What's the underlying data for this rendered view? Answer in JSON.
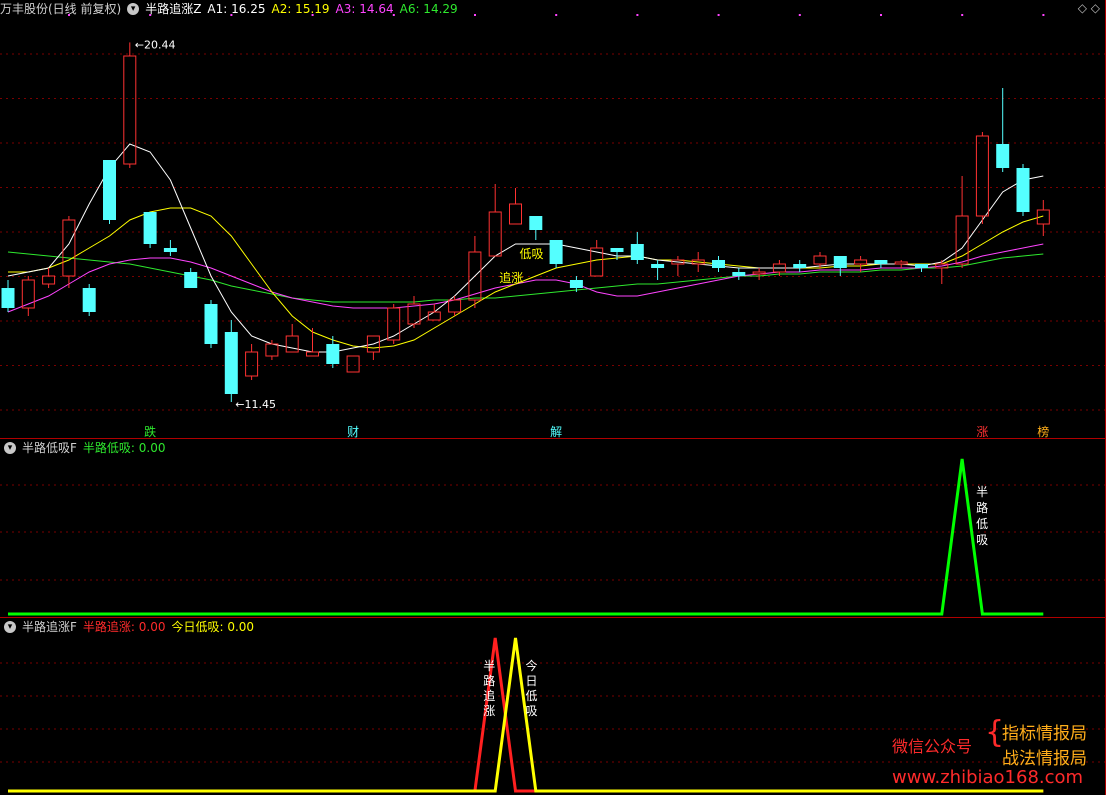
{
  "top_header": {
    "stock": "万丰股份(日线 前复权)",
    "indicator": "半路追涨Z",
    "a1": "A1: 16.25",
    "a2": "A2: 15.19",
    "a3": "A3: 14.64",
    "a6": "A6: 14.29"
  },
  "panel2_header": {
    "name": "半路低吸F",
    "series": "半路低吸: 0.00"
  },
  "panel3_header": {
    "name": "半路追涨F",
    "series1": "半路追涨: 0.00",
    "series2": "今日低吸: 0.00"
  },
  "watermark": {
    "left": "微信公众号",
    "right1": "指标情报局",
    "right2": "战法情报局",
    "url": "www.zhibiao168.com"
  },
  "colors": {
    "up": "#ff3232",
    "down": "#54ffff",
    "ma_white": "#ffffff",
    "ma_yellow": "#ffff00",
    "ma_magenta": "#ff44ff",
    "ma_green": "#2ee82e",
    "signal_green": "#00ff00",
    "signal_red": "#ff2020",
    "signal_yellow": "#ffff00",
    "grid": "#7a0000",
    "divider": "#b00000"
  },
  "chart_data": [
    {
      "type": "candlestick",
      "title": "半路追涨Z",
      "y_range": [
        11.0,
        21.0
      ],
      "grid": true,
      "annotations": {
        "max_label": "20.44",
        "min_label": "11.45",
        "signals": [
          {
            "index": 7,
            "text": "跌"
          },
          {
            "index": 17,
            "text": "财"
          },
          {
            "index": 27,
            "text": "解"
          },
          {
            "index": 48,
            "text": "涨"
          },
          {
            "index": 51,
            "text": "榜"
          }
        ],
        "chart_texts": [
          {
            "index": 25,
            "text": "低吸",
            "price": 15.05
          },
          {
            "index": 24,
            "text": "追涨",
            "price": 14.45
          }
        ]
      },
      "candles": [
        [
          14.3,
          13.8,
          14.5,
          13.7
        ],
        [
          13.8,
          14.5,
          14.6,
          13.6
        ],
        [
          14.4,
          14.6,
          14.8,
          14.3
        ],
        [
          14.6,
          16.0,
          16.1,
          14.3
        ],
        [
          14.3,
          13.7,
          14.4,
          13.6
        ],
        [
          17.5,
          16.0,
          17.5,
          15.9
        ],
        [
          17.4,
          20.1,
          20.44,
          17.3
        ],
        [
          16.2,
          15.4,
          16.2,
          15.3
        ],
        [
          15.3,
          15.2,
          15.5,
          15.1
        ],
        [
          14.7,
          14.3,
          14.8,
          14.3
        ],
        [
          13.9,
          12.9,
          14.0,
          12.8
        ],
        [
          13.2,
          11.65,
          13.5,
          11.45
        ],
        [
          12.1,
          12.7,
          12.9,
          12.0
        ],
        [
          12.6,
          12.9,
          13.0,
          12.5
        ],
        [
          12.7,
          13.1,
          13.4,
          12.7
        ],
        [
          12.6,
          12.7,
          13.3,
          12.6
        ],
        [
          12.9,
          12.4,
          13.1,
          12.3
        ],
        [
          12.2,
          12.6,
          12.6,
          12.2
        ],
        [
          12.7,
          13.1,
          13.1,
          12.5
        ],
        [
          13.0,
          13.8,
          13.9,
          12.9
        ],
        [
          13.4,
          13.9,
          14.1,
          13.3
        ],
        [
          13.5,
          13.7,
          13.9,
          13.5
        ],
        [
          13.7,
          14.0,
          14.1,
          13.6
        ],
        [
          14.0,
          15.2,
          15.6,
          13.8
        ],
        [
          15.1,
          16.2,
          16.9,
          15.1
        ],
        [
          15.9,
          16.4,
          16.8,
          15.9
        ],
        [
          16.1,
          15.75,
          16.1,
          15.5
        ],
        [
          15.5,
          14.9,
          15.5,
          14.8
        ],
        [
          14.5,
          14.3,
          14.6,
          14.2
        ],
        [
          14.6,
          15.3,
          15.5,
          14.6
        ],
        [
          15.3,
          15.2,
          15.3,
          15.0
        ],
        [
          15.4,
          15.0,
          15.7,
          14.9
        ],
        [
          14.9,
          14.8,
          15.0,
          14.5
        ],
        [
          14.9,
          15.0,
          15.1,
          14.6
        ],
        [
          14.9,
          15.0,
          15.2,
          14.7
        ],
        [
          15.0,
          14.8,
          15.1,
          14.7
        ],
        [
          14.7,
          14.6,
          14.8,
          14.5
        ],
        [
          14.65,
          14.7,
          14.8,
          14.5
        ],
        [
          14.7,
          14.9,
          15.0,
          14.6
        ],
        [
          14.9,
          14.8,
          15.0,
          14.7
        ],
        [
          14.9,
          15.1,
          15.2,
          14.8
        ],
        [
          15.1,
          14.8,
          15.1,
          14.6
        ],
        [
          14.9,
          15.0,
          15.1,
          14.7
        ],
        [
          15.0,
          14.9,
          15.0,
          14.8
        ],
        [
          14.9,
          14.95,
          15.0,
          14.8
        ],
        [
          14.9,
          14.8,
          14.9,
          14.7
        ],
        [
          14.8,
          14.9,
          15.0,
          14.4
        ],
        [
          14.9,
          16.1,
          17.1,
          14.8
        ],
        [
          16.1,
          18.1,
          18.2,
          15.9
        ],
        [
          17.9,
          17.3,
          19.3,
          17.2
        ],
        [
          17.3,
          16.2,
          17.4,
          16.1
        ],
        [
          15.9,
          16.25,
          16.5,
          15.6
        ]
      ],
      "ma_white": [
        14.6,
        14.7,
        14.8,
        15.4,
        16.4,
        17.3,
        17.9,
        17.7,
        17.0,
        15.8,
        14.6,
        13.7,
        13.1,
        12.9,
        12.8,
        12.7,
        12.7,
        12.8,
        12.9,
        13.1,
        13.4,
        13.7,
        14.1,
        14.6,
        15.1,
        15.4,
        15.4,
        15.4,
        15.3,
        15.2,
        15.1,
        15.1,
        15.0,
        14.95,
        14.9,
        14.85,
        14.8,
        14.8,
        14.8,
        14.8,
        14.85,
        14.9,
        14.9,
        14.9,
        14.9,
        14.85,
        14.95,
        15.3,
        16.0,
        16.7,
        17.0,
        17.1
      ],
      "ma_yellow": [
        14.7,
        14.7,
        14.8,
        15.0,
        15.3,
        15.6,
        16.0,
        16.2,
        16.3,
        16.3,
        16.1,
        15.6,
        14.9,
        14.2,
        13.6,
        13.2,
        13.0,
        12.85,
        12.8,
        12.85,
        13.0,
        13.3,
        13.6,
        13.9,
        14.2,
        14.4,
        14.6,
        14.8,
        14.9,
        15.0,
        15.05,
        15.1,
        15.0,
        15.0,
        14.95,
        14.9,
        14.85,
        14.8,
        14.8,
        14.8,
        14.8,
        14.85,
        14.85,
        14.9,
        14.9,
        14.9,
        14.9,
        15.1,
        15.4,
        15.7,
        15.95,
        16.1
      ],
      "ma_magenta": [
        13.7,
        13.9,
        14.1,
        14.4,
        14.7,
        14.9,
        15.0,
        15.05,
        15.05,
        14.95,
        14.8,
        14.6,
        14.4,
        14.2,
        14.05,
        13.95,
        13.85,
        13.8,
        13.8,
        13.8,
        13.85,
        13.9,
        14.0,
        14.15,
        14.3,
        14.4,
        14.5,
        14.5,
        14.4,
        14.2,
        14.1,
        14.1,
        14.2,
        14.3,
        14.4,
        14.5,
        14.6,
        14.65,
        14.7,
        14.7,
        14.75,
        14.75,
        14.75,
        14.8,
        14.8,
        14.8,
        14.85,
        14.95,
        15.1,
        15.2,
        15.3,
        15.4
      ],
      "ma_green": [
        15.2,
        15.15,
        15.1,
        15.05,
        15.0,
        14.95,
        14.9,
        14.8,
        14.7,
        14.6,
        14.5,
        14.35,
        14.25,
        14.15,
        14.05,
        14.0,
        13.95,
        13.95,
        13.95,
        13.95,
        13.95,
        14.0,
        14.0,
        14.05,
        14.05,
        14.1,
        14.15,
        14.2,
        14.25,
        14.3,
        14.35,
        14.4,
        14.4,
        14.45,
        14.5,
        14.55,
        14.6,
        14.6,
        14.65,
        14.65,
        14.7,
        14.7,
        14.7,
        14.75,
        14.75,
        14.8,
        14.8,
        14.85,
        14.95,
        15.05,
        15.1,
        15.15
      ]
    },
    {
      "type": "line",
      "title": "半路低吸F",
      "series": [
        {
          "name": "半路低吸",
          "spikes": [
            {
              "index": 47,
              "value": 1
            }
          ]
        }
      ],
      "annotations": [
        {
          "index": 47,
          "text": "半路低吸"
        }
      ]
    },
    {
      "type": "line",
      "title": "半路追涨F",
      "series": [
        {
          "name": "半路追涨",
          "spikes": [
            {
              "index": 24,
              "value": 1
            }
          ]
        },
        {
          "name": "今日低吸",
          "spikes": [
            {
              "index": 25,
              "value": 1
            }
          ]
        }
      ],
      "annotations": [
        {
          "index": 24,
          "text": "半路追涨"
        },
        {
          "index": 25,
          "text": "今日低吸"
        }
      ]
    }
  ]
}
